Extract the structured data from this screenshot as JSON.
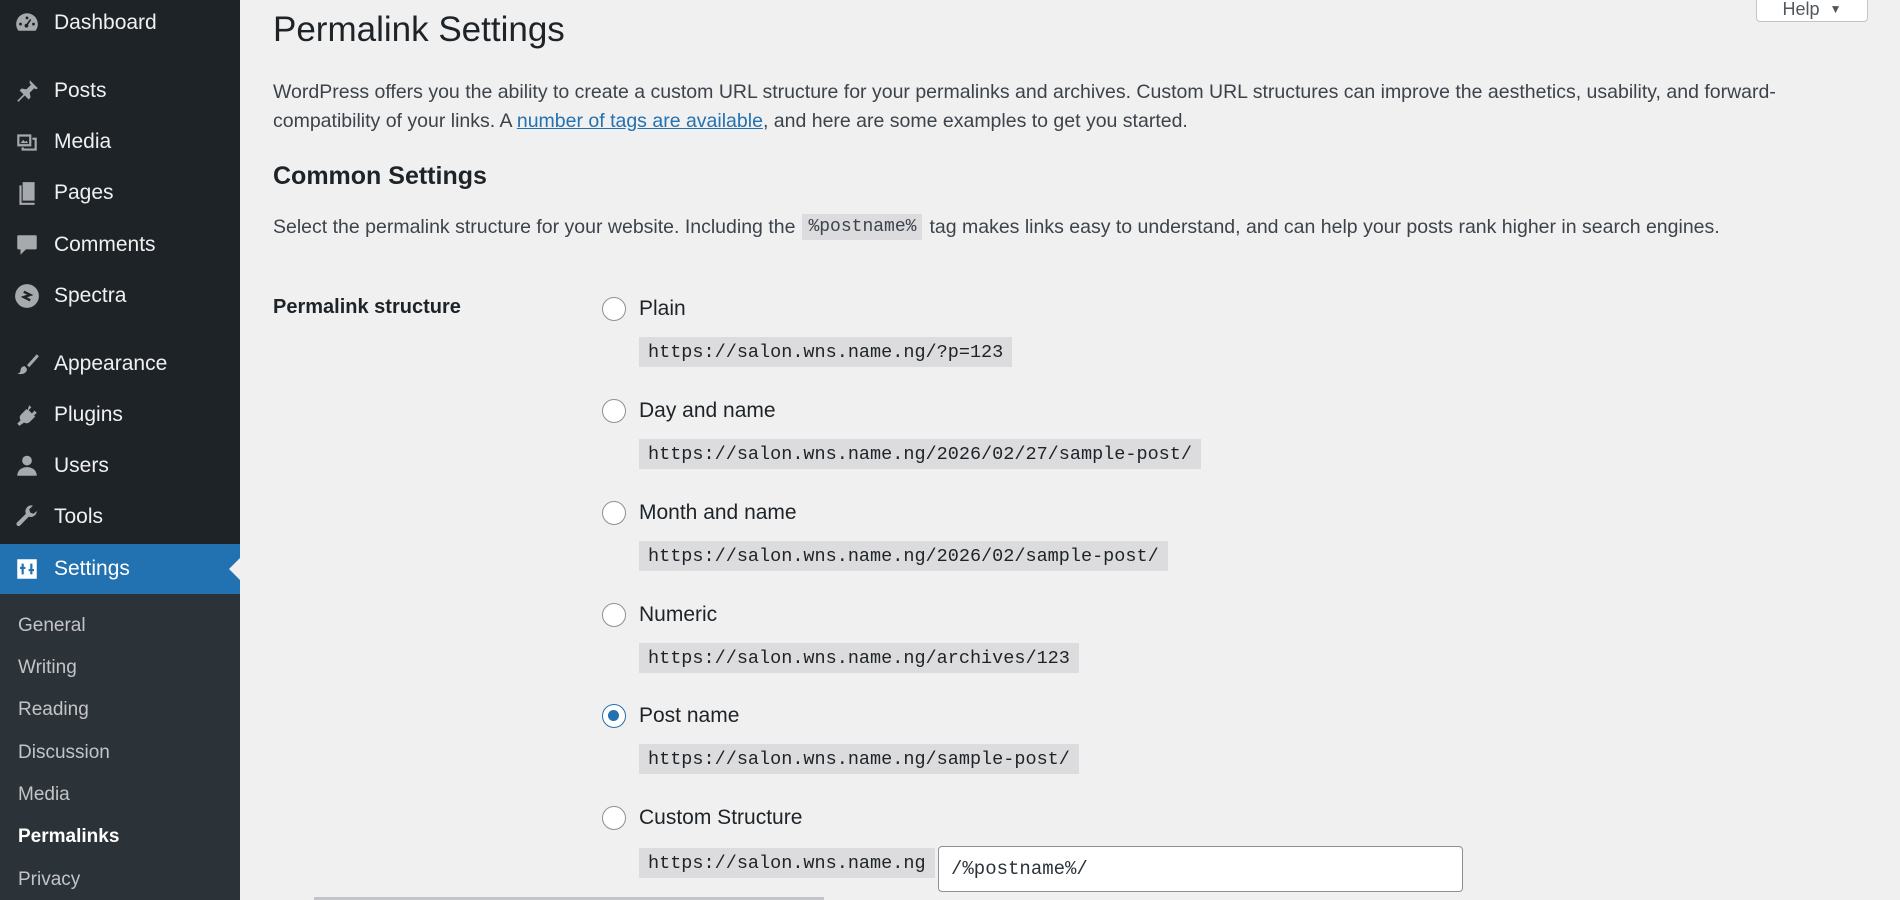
{
  "sidebar": {
    "menu": [
      {
        "label": "Dashboard",
        "icon": "dashboard-icon"
      },
      {
        "label": "Posts",
        "icon": "pin-icon"
      },
      {
        "label": "Media",
        "icon": "media-icon"
      },
      {
        "label": "Pages",
        "icon": "pages-icon"
      },
      {
        "label": "Comments",
        "icon": "comment-icon"
      },
      {
        "label": "Spectra",
        "icon": "spectra-icon"
      },
      {
        "label": "Appearance",
        "icon": "brush-icon"
      },
      {
        "label": "Plugins",
        "icon": "plug-icon"
      },
      {
        "label": "Users",
        "icon": "user-icon"
      },
      {
        "label": "Tools",
        "icon": "wrench-icon"
      },
      {
        "label": "Settings",
        "icon": "settings-icon"
      }
    ],
    "submenu": [
      "General",
      "Writing",
      "Reading",
      "Discussion",
      "Media",
      "Permalinks",
      "Privacy"
    ],
    "active_menu": "Settings",
    "current_submenu": "Permalinks",
    "accent_color": "#2271b1"
  },
  "help": {
    "label": "Help"
  },
  "page": {
    "title": "Permalink Settings",
    "intro_before_link": "WordPress offers you the ability to create a custom URL structure for your permalinks and archives. Custom URL structures can improve the aesthetics, usability, and forward-compatibility of your links. A ",
    "intro_link": "number of tags are available",
    "intro_after_link": ", and here are some examples to get you started.",
    "section_title": "Common Settings",
    "section_desc_before": "Select the permalink structure for your website. Including the",
    "section_desc_code": "%postname%",
    "section_desc_after": "tag makes links easy to understand, and can help your posts rank higher in search engines.",
    "row_label": "Permalink structure"
  },
  "options": [
    {
      "label": "Plain",
      "example": "https://salon.wns.name.ng/?p=123",
      "checked": false
    },
    {
      "label": "Day and name",
      "example": "https://salon.wns.name.ng/2026/02/27/sample-post/",
      "checked": false
    },
    {
      "label": "Month and name",
      "example": "https://salon.wns.name.ng/2026/02/sample-post/",
      "checked": false
    },
    {
      "label": "Numeric",
      "example": "https://salon.wns.name.ng/archives/123",
      "checked": false
    },
    {
      "label": "Post name",
      "example": "https://salon.wns.name.ng/sample-post/",
      "checked": true
    },
    {
      "label": "Custom Structure",
      "example": "https://salon.wns.name.ng",
      "checked": false
    }
  ],
  "custom_structure_value": "/%postname%/"
}
